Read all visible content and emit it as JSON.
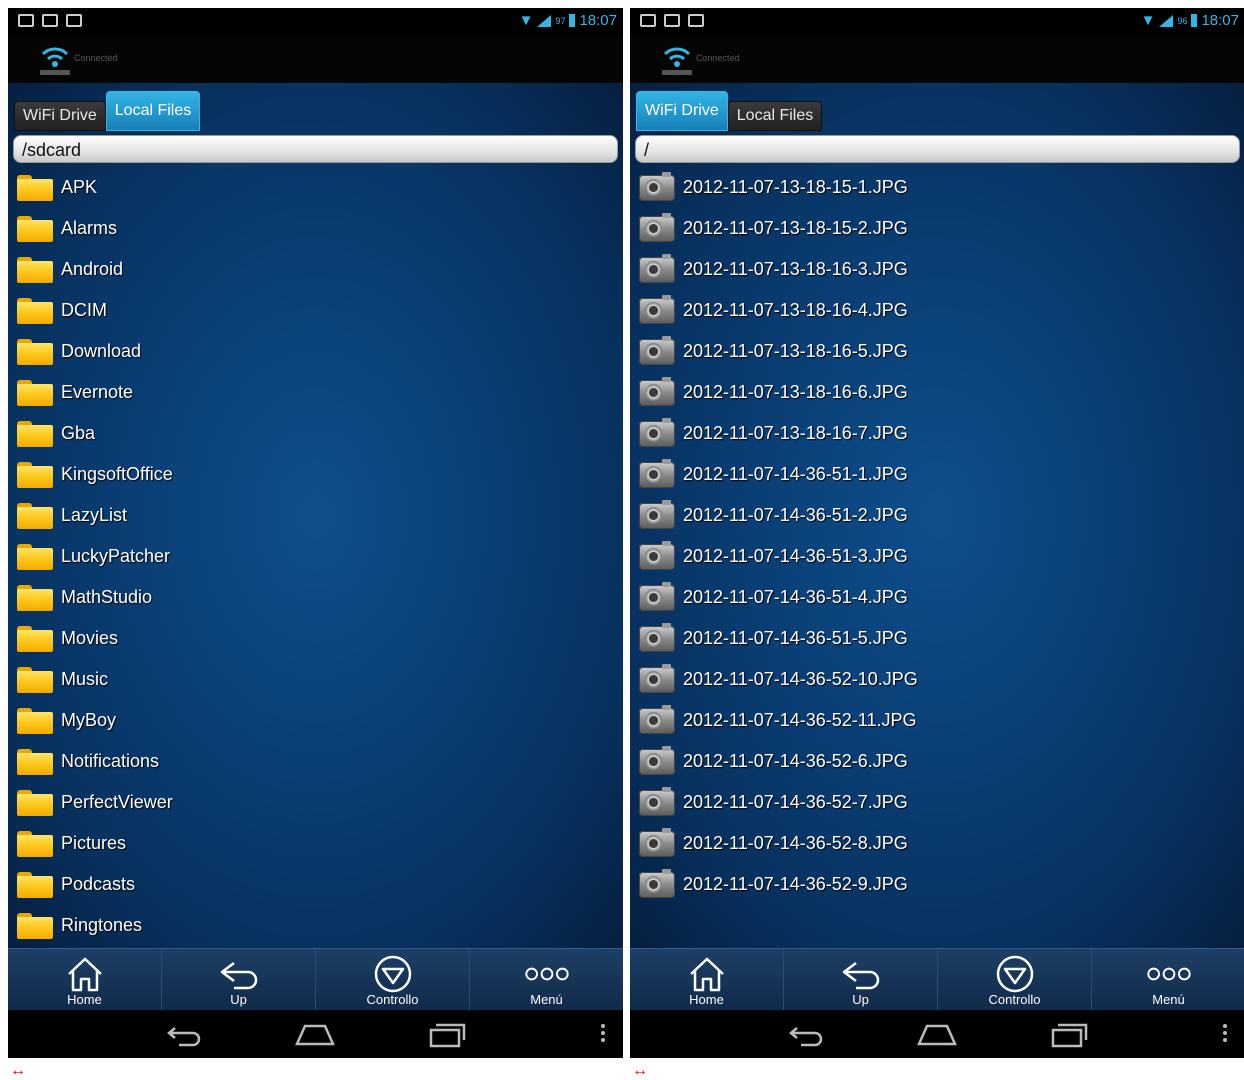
{
  "status_bar": {
    "time": "18:07"
  },
  "header": {
    "connected_label": "Connected"
  },
  "screens": [
    {
      "tabs": [
        "WiFi Drive",
        "Local Files"
      ],
      "active_tab": 1,
      "path": "/sdcard",
      "items": [
        "APK",
        "Alarms",
        "Android",
        "DCIM",
        "Download",
        "Evernote",
        "Gba",
        "KingsoftOffice",
        "LazyList",
        "LuckyPatcher",
        "MathStudio",
        "Movies",
        "Music",
        "MyBoy",
        "Notifications",
        "PerfectViewer",
        "Pictures",
        "Podcasts",
        "Ringtones"
      ]
    },
    {
      "tabs": [
        "WiFi Drive",
        "Local Files"
      ],
      "active_tab": 0,
      "path": "/",
      "items": [
        "2012-11-07-13-18-15-1.JPG",
        "2012-11-07-13-18-15-2.JPG",
        "2012-11-07-13-18-16-3.JPG",
        "2012-11-07-13-18-16-4.JPG",
        "2012-11-07-13-18-16-5.JPG",
        "2012-11-07-13-18-16-6.JPG",
        "2012-11-07-13-18-16-7.JPG",
        "2012-11-07-14-36-51-1.JPG",
        "2012-11-07-14-36-51-2.JPG",
        "2012-11-07-14-36-51-3.JPG",
        "2012-11-07-14-36-51-4.JPG",
        "2012-11-07-14-36-51-5.JPG",
        "2012-11-07-14-36-52-10.JPG",
        "2012-11-07-14-36-52-11.JPG",
        "2012-11-07-14-36-52-6.JPG",
        "2012-11-07-14-36-52-7.JPG",
        "2012-11-07-14-36-52-8.JPG",
        "2012-11-07-14-36-52-9.JPG"
      ]
    }
  ],
  "toolbar": {
    "home": "Home",
    "up": "Up",
    "control": "Controllo",
    "menu": "Menú"
  },
  "caption": "↔",
  "colors": {
    "accent": "#33b5e5",
    "folder": "#ffc820",
    "app_bg": "#0a3f76"
  }
}
